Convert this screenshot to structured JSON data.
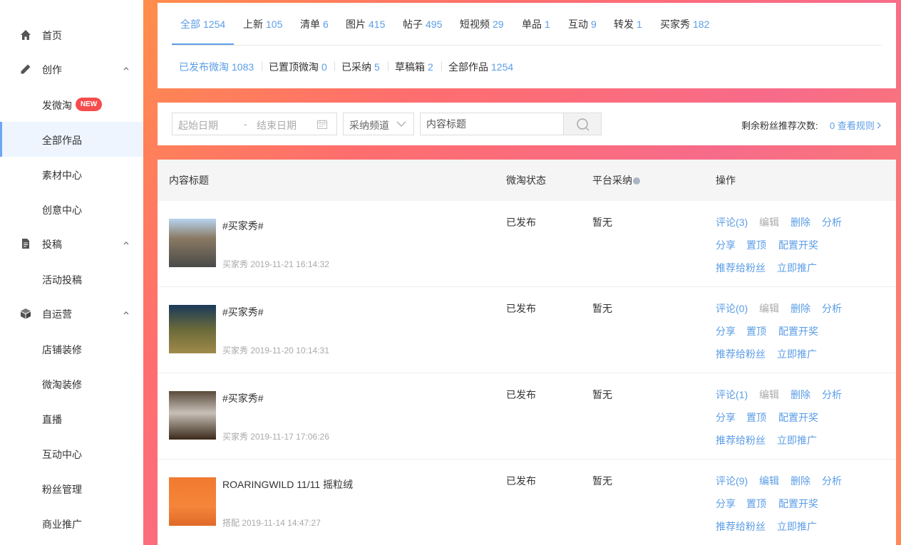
{
  "sidebar": {
    "home": "首页",
    "create": "创作",
    "post_weitao": "发微淘",
    "new_badge": "NEW",
    "all_works": "全部作品",
    "material_center": "素材中心",
    "idea_center": "创意中心",
    "submission": "投稿",
    "activity_submission": "活动投稿",
    "self_operation": "自运营",
    "shop_decoration": "店铺装修",
    "weitao_decoration": "微淘装修",
    "live": "直播",
    "interaction_center": "互动中心",
    "fans_management": "粉丝管理",
    "commercial_promotion": "商业推广"
  },
  "tabs": [
    {
      "label": "全部",
      "count": "1254"
    },
    {
      "label": "上新",
      "count": "105"
    },
    {
      "label": "清单",
      "count": "6"
    },
    {
      "label": "图片",
      "count": "415"
    },
    {
      "label": "帖子",
      "count": "495"
    },
    {
      "label": "短视频",
      "count": "29"
    },
    {
      "label": "单品",
      "count": "1"
    },
    {
      "label": "互动",
      "count": "9"
    },
    {
      "label": "转发",
      "count": "1"
    },
    {
      "label": "买家秀",
      "count": "182"
    }
  ],
  "subtabs": [
    {
      "label": "已发布微淘",
      "count": "1083"
    },
    {
      "label": "已置顶微淘",
      "count": "0"
    },
    {
      "label": "已采纳",
      "count": "5"
    },
    {
      "label": "草稿箱",
      "count": "2"
    },
    {
      "label": "全部作品",
      "count": "1254"
    }
  ],
  "filters": {
    "start_date": "起始日期",
    "date_sep": "-",
    "end_date": "结束日期",
    "channel": "采纳频道",
    "title_placeholder": "内容标题",
    "fans_label": "剩余粉丝推荐次数:",
    "fans_value": "0 查看规则"
  },
  "table": {
    "headers": [
      "内容标题",
      "微淘状态",
      "平台采纳",
      "操作"
    ],
    "rows": [
      {
        "title": "#买家秀#",
        "meta": "买家秀 2019-11-21 16:14:32",
        "status": "已发布",
        "adopt": "暂无",
        "comment": "评论(3)",
        "edit": "编辑",
        "edit_disabled": true
      },
      {
        "title": "#买家秀#",
        "meta": "买家秀 2019-11-20 10:14:31",
        "status": "已发布",
        "adopt": "暂无",
        "comment": "评论(0)",
        "edit": "编辑",
        "edit_disabled": true
      },
      {
        "title": "#买家秀#",
        "meta": "买家秀 2019-11-17 17:06:26",
        "status": "已发布",
        "adopt": "暂无",
        "comment": "评论(1)",
        "edit": "编辑",
        "edit_disabled": true
      },
      {
        "title": "ROARINGWILD 11/11 摇粒绒",
        "meta": "搭配 2019-11-14 14:47:27",
        "status": "已发布",
        "adopt": "暂无",
        "comment": "评论(9)",
        "edit": "编辑",
        "edit_disabled": false
      }
    ],
    "ops": {
      "delete": "删除",
      "analyze": "分析",
      "share": "分享",
      "pin": "置顶",
      "lottery": "配置开奖",
      "recommend": "推荐给粉丝",
      "promote": "立即推广"
    }
  },
  "colors": {
    "accent": "#5b9de6",
    "badge": "#f54d4d"
  }
}
